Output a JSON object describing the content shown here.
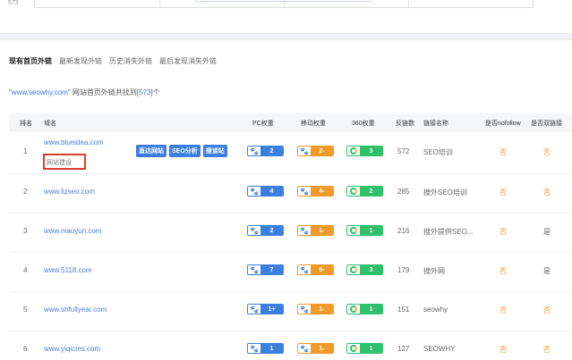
{
  "chart_top": {
    "axis_value": "573"
  },
  "tabs": [
    {
      "label": "现有首页外链",
      "active": true
    },
    {
      "label": "最新发现外链",
      "active": false
    },
    {
      "label": "历史消失外链",
      "active": false
    },
    {
      "label": "最后发现消失外链",
      "active": false
    }
  ],
  "summary": {
    "domain": "\"www.seowhy.com\"",
    "text_mid": " 网站首页外链共找到[",
    "count": "573",
    "text_end": "]个"
  },
  "table": {
    "headers": {
      "rank": "排名",
      "domain": "域名",
      "pc": "PC权重",
      "mobile": "移动权重",
      "s360": "360权重",
      "backlinks": "反链数",
      "anchor": "链接名称",
      "nofollow": "是否nofollow",
      "pwd": "是否双链接"
    },
    "tags": [
      "直达网站",
      "SEO分析",
      "搜谈站"
    ],
    "site_tag": "网站建设",
    "rows": [
      {
        "rank": "1",
        "domain": "www.blueidea.com",
        "pc": "2",
        "mobile": "2-",
        "s360": "3",
        "backlinks": "572",
        "anchor": "SEO培训",
        "nofollow": "否",
        "pwd": "否"
      },
      {
        "rank": "2",
        "domain": "www.lizseo.com",
        "pc": "4",
        "mobile": "4-",
        "s360": "2",
        "backlinks": "285",
        "anchor": "搜外SEO培训",
        "nofollow": "否",
        "pwd": "否"
      },
      {
        "rank": "3",
        "domain": "www.niaoyun.com",
        "pc": "2",
        "mobile": "1-",
        "s360": "1",
        "backlinks": "216",
        "anchor": "搜外提供SEO...",
        "nofollow": "否",
        "pwd": "是"
      },
      {
        "rank": "4",
        "domain": "www.5118.com",
        "pc": "7",
        "mobile": "5-",
        "s360": "3",
        "backlinks": "179",
        "anchor": "搜外网",
        "nofollow": "否",
        "pwd": "是"
      },
      {
        "rank": "5",
        "domain": "www.shfullyear.com",
        "pc": "1+",
        "mobile": "1-",
        "s360": "1",
        "backlinks": "151",
        "anchor": "seowhy",
        "nofollow": "否",
        "pwd": "否"
      },
      {
        "rank": "6",
        "domain": "www.yiqicms.com",
        "pc": "1",
        "mobile": "1-",
        "s360": "1",
        "backlinks": "127",
        "anchor": "SEOWHY",
        "nofollow": "否",
        "pwd": "否"
      }
    ]
  },
  "colors": {
    "pc": "#3b7fe0",
    "mobile": "#f09a2a",
    "s360": "#2ec06b",
    "link": "#4a7fd6",
    "highlight_box": "#d9402c"
  },
  "icons": {
    "pc": "paw-icon",
    "mobile": "paw-icon",
    "s360": "ring-icon"
  }
}
